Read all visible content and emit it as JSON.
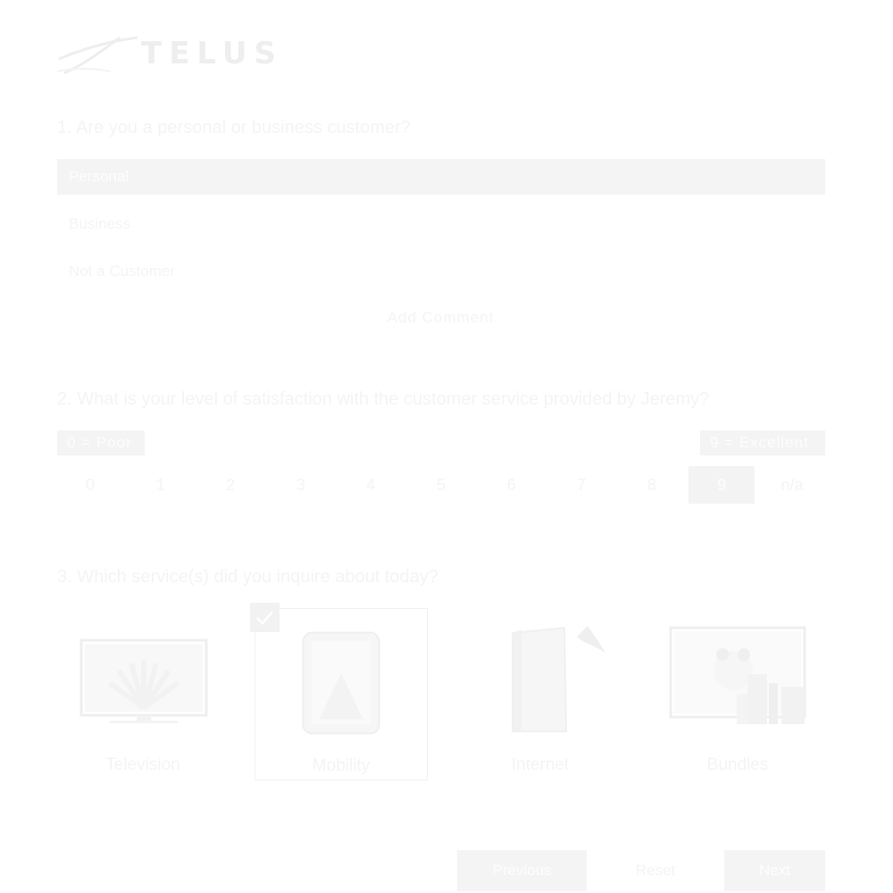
{
  "brand": {
    "name": "TELUS"
  },
  "q1": {
    "question": "1. Are you a personal or business customer?",
    "options": [
      {
        "label": "Personal",
        "selected": true
      },
      {
        "label": "Business",
        "selected": false
      },
      {
        "label": "Not a Customer",
        "selected": false
      }
    ],
    "add_comment": "Add Comment"
  },
  "q2": {
    "question": "2. What is your level of satisfaction with the customer service provided by Jeremy?",
    "low_label": "0 = Poor",
    "high_label": "9 = Excellent",
    "ratings": [
      "0",
      "1",
      "2",
      "3",
      "4",
      "5",
      "6",
      "7",
      "8",
      "9",
      "n/a"
    ],
    "selected": "9"
  },
  "q3": {
    "question": "3. Which service(s) did you inquire about today?",
    "services": [
      {
        "label": "Television",
        "icon": "television-icon",
        "selected": false
      },
      {
        "label": "Mobility",
        "icon": "smartphone-icon",
        "selected": true
      },
      {
        "label": "Internet",
        "icon": "modem-icon",
        "selected": false
      },
      {
        "label": "Bundles",
        "icon": "bundle-panda-icon",
        "selected": false
      }
    ]
  },
  "nav": {
    "previous": "Previous",
    "reset": "Reset",
    "next": "Next"
  },
  "colors": {
    "faded_text": "#f4f4f4",
    "selected_fill": "#f4f4f4",
    "background": "#ffffff"
  }
}
